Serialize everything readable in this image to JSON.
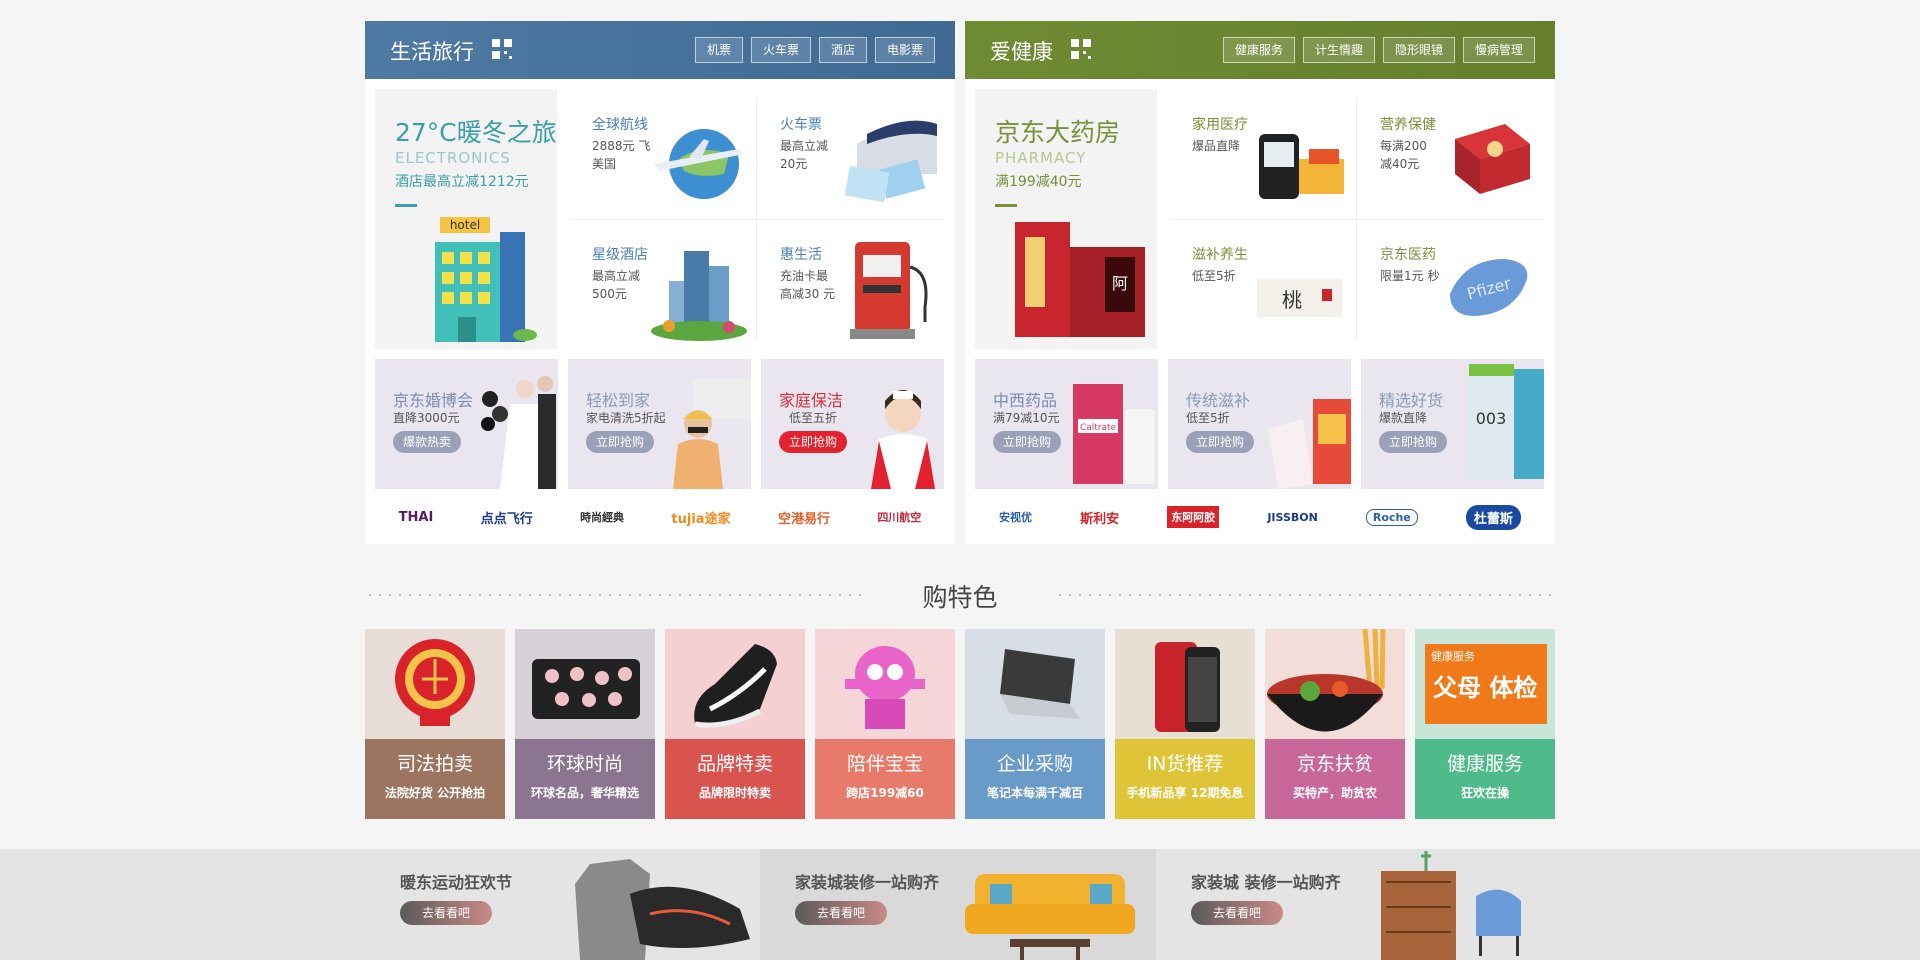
{
  "travel": {
    "title": "生活旅行",
    "tags": [
      "机票",
      "火车票",
      "酒店",
      "电影票"
    ],
    "hero": {
      "title": "27°C暖冬之旅",
      "subtitle": "ELECTRONICS",
      "desc": "酒店最高立减1212元"
    },
    "cells": [
      {
        "title": "全球航线",
        "desc": "2888元 飞美国"
      },
      {
        "title": "火车票",
        "desc": "最高立减 20元"
      },
      {
        "title": "星级酒店",
        "desc": "最高立减 500元"
      },
      {
        "title": "惠生活",
        "desc": "充油卡最 高减30 元"
      }
    ],
    "promos": [
      {
        "title": "京东婚博会",
        "sub": "直降3000元",
        "btn": "爆款热卖"
      },
      {
        "title": "轻松到家",
        "sub": "家电清洗5折起",
        "btn": "立即抢购"
      },
      {
        "title": "家庭保洁",
        "sub": "低至五折",
        "btn": "立即抢购"
      }
    ],
    "brands": [
      "THAI",
      "点点飞行",
      "時尚經典",
      "tujia途家",
      "空港易行",
      "四川航空"
    ]
  },
  "health": {
    "title": "爱健康",
    "tags": [
      "健康服务",
      "计生情趣",
      "隐形眼镜",
      "慢病管理"
    ],
    "hero": {
      "title": "京东大药房",
      "subtitle": "PHARMACY",
      "desc": "满199减40元"
    },
    "cells": [
      {
        "title": "家用医疗",
        "desc": "爆品直降"
      },
      {
        "title": "营养保健",
        "desc": "每满200 减40元"
      },
      {
        "title": "滋补养生",
        "desc": "低至5折"
      },
      {
        "title": "京东医药",
        "desc": "限量1元 秒"
      }
    ],
    "promos": [
      {
        "title": "中西药品",
        "sub": "满79减10元",
        "btn": "立即抢购"
      },
      {
        "title": "传统滋补",
        "sub": "低至5折",
        "btn": "立即抢购"
      },
      {
        "title": "精选好货",
        "sub": "爆款直降",
        "btn": "立即抢购"
      }
    ],
    "brands": [
      "安视优",
      "斯利安",
      "东阿阿胶",
      "JISSBON",
      "Roche",
      "杜蕾斯"
    ]
  },
  "featured": {
    "title": "购特色",
    "items": [
      {
        "title": "司法拍卖",
        "sub": "法院好货 公开抢拍"
      },
      {
        "title": "环球时尚",
        "sub": "环球名品，奢华精选"
      },
      {
        "title": "品牌特卖",
        "sub": "品牌限时特卖"
      },
      {
        "title": "陪伴宝宝",
        "sub": "跨店199减60"
      },
      {
        "title": "企业采购",
        "sub": "笔记本每满千减百"
      },
      {
        "title": "IN货推荐",
        "sub": "手机新品享 12期免息"
      },
      {
        "title": "京东扶贫",
        "sub": "买特产，助贫农"
      },
      {
        "title": "健康服务",
        "sub": "狂欢在操"
      }
    ],
    "health_badge": "健康服务",
    "health_img_text": "父母 体检"
  },
  "bottom": [
    {
      "title": "暖东运动狂欢节",
      "btn": "去看看吧"
    },
    {
      "title": "家装城装修一站购齐",
      "btn": "去看看吧"
    },
    {
      "title": "家装城 装修一站购齐",
      "btn": "去看看吧"
    }
  ],
  "colors": {
    "travel": "#4a76a0",
    "health": "#6e8a33"
  }
}
